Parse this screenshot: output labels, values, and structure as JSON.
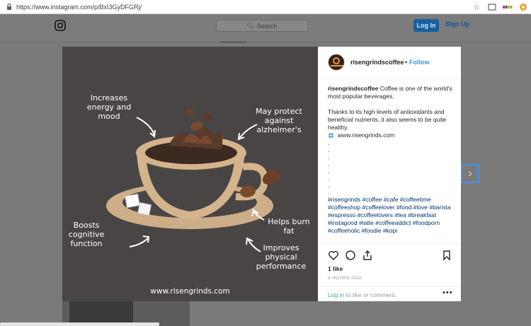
{
  "browser": {
    "url": "https://www.instagram.com/p/BxI3GyDFGRj/"
  },
  "header": {
    "search_placeholder": "Search",
    "login_label": "Log In",
    "signup_label": "Sign Up"
  },
  "post": {
    "image_texts": {
      "t1": "Increases energy and mood",
      "t2": "May protect against alzheimer's",
      "t3": "Boosts cognitive function",
      "t4": "Helps burn fat",
      "t5": "Improves physical performance",
      "site": "www.risengrinds.com"
    },
    "username": "risengrindscoffee",
    "separator": "•",
    "follow_label": "Follow",
    "caption_user": "risengrindscoffee",
    "caption_line1": " Coffee is one of the world's most popular beverages.",
    "caption_line2": "Thanks to its high levels of antioxidants and beneficial nutrients, it also seems to be quite healthy.",
    "caption_link": "www.risengrinds.com",
    "dots": [
      ".",
      ".",
      ".",
      ".",
      ".",
      ".",
      ".",
      "."
    ],
    "hashtags": "#risengrinds #coffee #cafe #coffeetime #coffeeshop #coffeelover #food #love #barista #espresso #coffeelovers #tea #breakfast #instagood #latte #coffeeaddict #foodporn #coffeeholic #foodie #kopi",
    "likes": "1 like",
    "time_ago": "4 HOURS AGO",
    "login_link": "Log in",
    "comment_suffix": " to like or comment.",
    "more": "•••"
  },
  "colors": {
    "accent": "#3897f0",
    "login_button": "#1b5ea0",
    "image_bg": "#4a4545",
    "coffee_tan": "#d4b48c"
  }
}
